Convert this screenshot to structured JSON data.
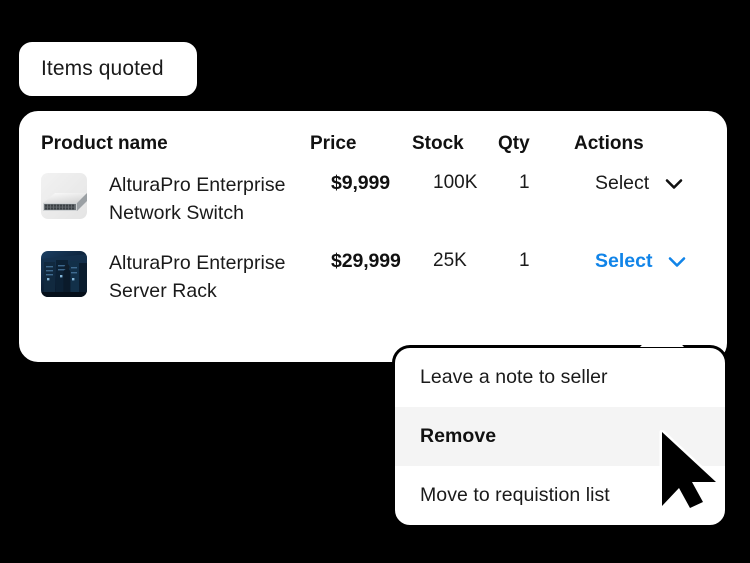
{
  "tab": {
    "label": "Items quoted"
  },
  "table": {
    "headers": {
      "product_name": "Product name",
      "price": "Price",
      "stock": "Stock",
      "qty": "Qty",
      "actions": "Actions"
    },
    "rows": [
      {
        "thumbnail": "network-switch-photo",
        "name": "AlturaPro Enterprise Network Switch",
        "price": "$9,999",
        "stock": "100K",
        "qty": "1",
        "action_label": "Select",
        "action_active": false
      },
      {
        "thumbnail": "server-rack-photo",
        "name": "AlturaPro Enterprise Server Rack",
        "price": "$29,999",
        "stock": "25K",
        "qty": "1",
        "action_label": "Select",
        "action_active": true
      }
    ]
  },
  "dropdown": {
    "items": [
      {
        "label": "Leave a note to seller",
        "highlighted": false
      },
      {
        "label": "Remove",
        "highlighted": true
      },
      {
        "label": "Move to requistion list",
        "highlighted": false
      }
    ]
  },
  "colors": {
    "background": "#000000",
    "surface": "#ffffff",
    "border": "#000000",
    "text": "#1a1a1a",
    "accent": "#1184e8",
    "highlight_row": "#f4f4f4"
  },
  "cursor": {
    "icon": "arrow-pointer"
  }
}
